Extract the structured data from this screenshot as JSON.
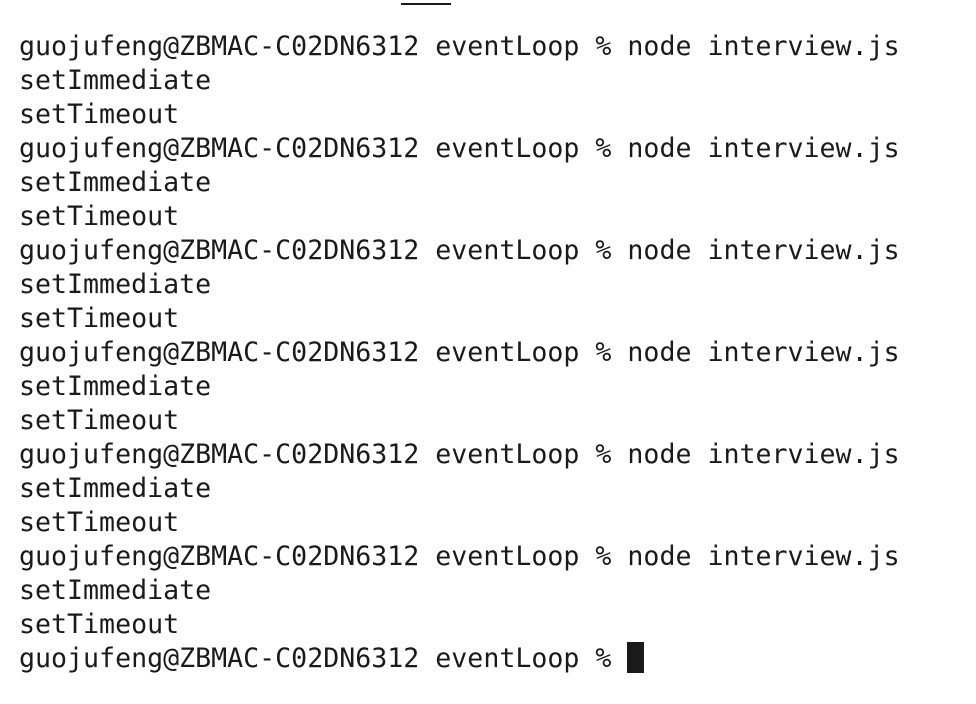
{
  "terminal": {
    "prompt": "guojufeng@ZBMAC-C02DN6312 eventLoop % ",
    "command": "node interview.js",
    "output_1": "setImmediate",
    "output_2": "setTimeout",
    "runs": [
      {
        "command": "node interview.js",
        "out1": "setImmediate",
        "out2": "setTimeout"
      },
      {
        "command": "node interview.js",
        "out1": "setImmediate",
        "out2": "setTimeout"
      },
      {
        "command": "node interview.js",
        "out1": "setImmediate",
        "out2": "setTimeout"
      },
      {
        "command": "node interview.js",
        "out1": "setImmediate",
        "out2": "setTimeout"
      },
      {
        "command": "node interview.js",
        "out1": "setImmediate",
        "out2": "setTimeout"
      },
      {
        "command": "node interview.js",
        "out1": "setImmediate",
        "out2": "setTimeout"
      }
    ],
    "final_prompt": "guojufeng@ZBMAC-C02DN6312 eventLoop % "
  }
}
